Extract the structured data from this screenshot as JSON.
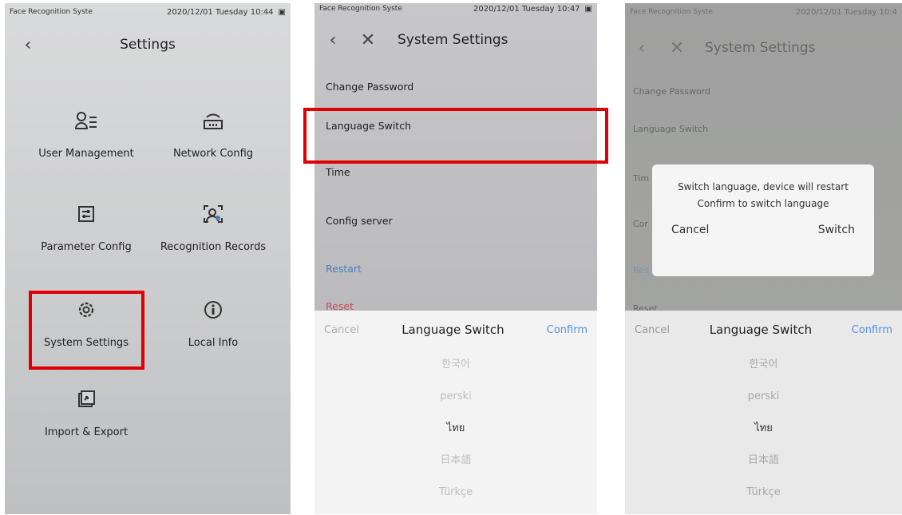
{
  "screen1": {
    "status": {
      "app": "Face Recognition Syste",
      "datetime": "2020/12/01 Tuesday 10:44",
      "battery_icon": "battery-icon"
    },
    "title": "Settings",
    "back_icon": "back-icon",
    "tiles": [
      {
        "label": "User Management",
        "icon": "user-list-icon"
      },
      {
        "label": "Network Config",
        "icon": "network-icon"
      },
      {
        "label": "Parameter Config",
        "icon": "parameter-icon"
      },
      {
        "label": "Recognition Records",
        "icon": "face-scan-icon"
      },
      {
        "label": "System Settings",
        "icon": "gear-icon"
      },
      {
        "label": "Local Info",
        "icon": "info-icon"
      },
      {
        "label": "Import & Export",
        "icon": "import-export-icon"
      }
    ]
  },
  "screen2": {
    "status": {
      "app": "Face Recognition Syste",
      "datetime": "2020/12/01 Tuesday 10:47"
    },
    "title": "System Settings",
    "menu": [
      "Change Password",
      "Language Switch",
      "Time",
      "Config server",
      "Restart",
      "Reset"
    ]
  },
  "screen3": {
    "status": {
      "app": "Face Recognition Syste",
      "datetime": "2020/12/01 Tuesday 10:4"
    },
    "title": "System Settings",
    "menu": [
      "Change Password",
      "Language Switch",
      "Tim",
      "Cor",
      "Res",
      "Reset"
    ],
    "dialog": {
      "line1": "Switch language, device will restart",
      "line2": "Confirm to switch language",
      "cancel": "Cancel",
      "switch": "Switch"
    }
  },
  "language_sheet": {
    "cancel": "Cancel",
    "title": "Language Switch",
    "confirm": "Confirm",
    "options": [
      "한국어",
      "perski",
      "ไทย",
      "日本語",
      "Türkçe"
    ],
    "selected": "ไทย"
  },
  "colors": {
    "highlight": "#e00000",
    "confirm_blue": "#5a8fd8"
  }
}
